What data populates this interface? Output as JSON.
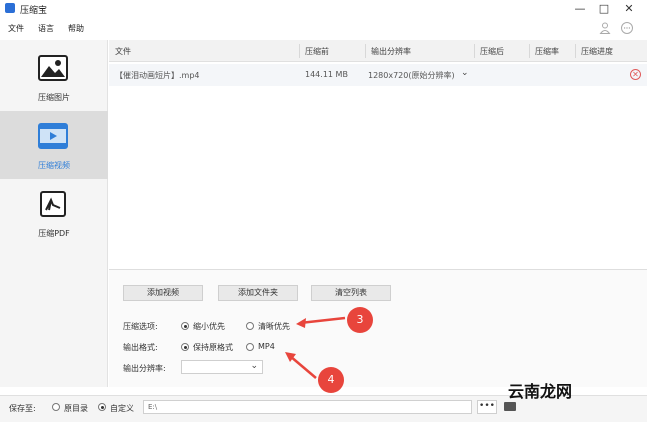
{
  "app": {
    "title": "压缩宝"
  },
  "window": {
    "minimize": "—",
    "maximize": "□",
    "close": "✕"
  },
  "menu": [
    "文件",
    "语言",
    "帮助"
  ],
  "sidebar": {
    "items": [
      {
        "label": "压缩图片",
        "icon": "image-icon"
      },
      {
        "label": "压缩视频",
        "icon": "video-icon",
        "active": true
      },
      {
        "label": "压缩PDF",
        "icon": "pdf-icon"
      }
    ]
  },
  "table": {
    "columns": [
      "文件",
      "压缩前",
      "输出分辨率",
      "压缩后",
      "压缩率",
      "压缩进度"
    ],
    "rows": [
      {
        "file": "【催泪动画短片】.mp4",
        "before": "144.11 MB",
        "resolution": "1280x720(原始分辨率)"
      }
    ]
  },
  "buttons": {
    "add_video": "添加视频",
    "add_folder": "添加文件夹",
    "clear_list": "清空列表"
  },
  "options": {
    "compress_label": "压缩选项:",
    "compress_small": "缩小优先",
    "compress_clear": "清晰优先",
    "format_label": "输出格式:",
    "format_keep": "保持原格式",
    "format_mp4": "MP4",
    "resolution_label": "输出分辨率:"
  },
  "save": {
    "label": "保存至:",
    "original": "原目录",
    "custom": "自定义",
    "path": "E:\\",
    "browse": "•••"
  },
  "callouts": [
    "3",
    "4"
  ],
  "watermark": "云南龙网",
  "colors": {
    "accent": "#2f7ed8",
    "callout": "#e8453c"
  }
}
